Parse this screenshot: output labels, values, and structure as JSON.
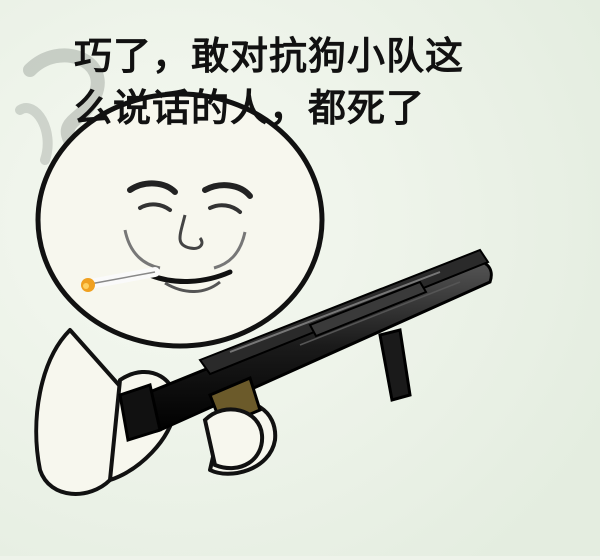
{
  "caption": {
    "line1": "巧了，敢对抗狗小队这",
    "line2": "么说话的人，都死了"
  },
  "icons": [
    "smoke-icon",
    "cigarette-icon",
    "rifle-icon"
  ],
  "colors": {
    "background": "#eef3ea",
    "ink": "#111111",
    "face": "#f7f7ee",
    "ember": "#f0a020"
  }
}
